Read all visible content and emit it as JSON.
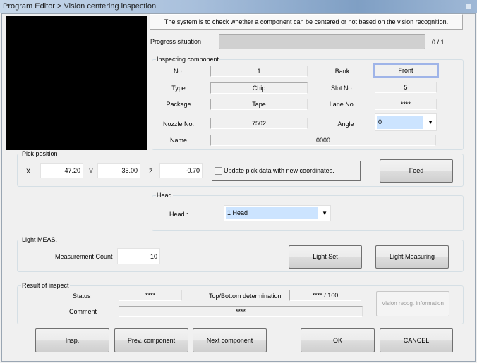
{
  "window": {
    "title": "Program Editor > Vision centering inspection"
  },
  "info_text": "The system is to check whether a component can be centered or not based on the vision recognition.",
  "progress": {
    "label": "Progress situation",
    "value": 0,
    "total": 1,
    "text": "0 / 1"
  },
  "inspecting": {
    "title": "Inspecting component",
    "no_label": "No.",
    "no": "1",
    "type_label": "Type",
    "type": "Chip",
    "package_label": "Package",
    "package": "Tape",
    "nozzle_label": "Nozzle No.",
    "nozzle": "7502",
    "name_label": "Name",
    "name": "0000",
    "bank_label": "Bank",
    "bank": "Front",
    "slot_label": "Slot No.",
    "slot": "5",
    "lane_label": "Lane No.",
    "lane": "****",
    "angle_label": "Angle",
    "angle": "0"
  },
  "pick": {
    "title": "Pick position",
    "x_label": "X",
    "x": "47.20",
    "y_label": "Y",
    "y": "35.00",
    "z_label": "Z",
    "z": "-0.70",
    "update_label": "Update pick data with new coordinates.",
    "update_checked": false,
    "feed": "Feed"
  },
  "head": {
    "title": "Head",
    "label": "Head  :",
    "value": "1 Head"
  },
  "light": {
    "title": "Light MEAS.",
    "count_label": "Measurement Count",
    "count": "10",
    "set": "Light Set",
    "measuring": "Light Measuring"
  },
  "result": {
    "title": "Result of inspect",
    "status_label": "Status",
    "status": "****",
    "tb_label": "Top/Bottom determination",
    "tb": "**** / 160",
    "comment_label": "Comment",
    "comment": "****",
    "vision_info": "Vision recog. information"
  },
  "buttons": {
    "insp": "Insp.",
    "prev": "Prev. component",
    "next": "Next component",
    "ok": "OK",
    "cancel": "CANCEL"
  }
}
